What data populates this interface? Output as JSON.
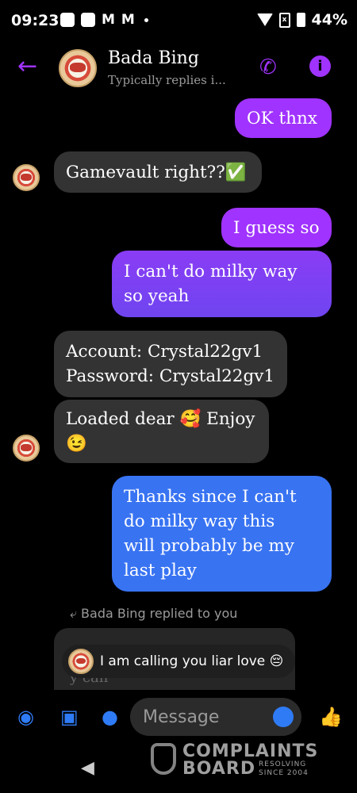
{
  "status_bar": {
    "time": "09:23",
    "gmail_1": "M",
    "gmail_2": "M",
    "sim": "x",
    "battery": "44%"
  },
  "header": {
    "back_icon": "arrow-left-icon",
    "contact_name": "Bada Bing",
    "subtitle": "Typically replies i...",
    "call_icon": "phone-icon",
    "info_label": "i"
  },
  "messages": [
    {
      "from": "me",
      "text": "OK thnx"
    },
    {
      "from": "them",
      "text": "Gamevault right??✅"
    },
    {
      "from": "me",
      "text": "I guess so"
    },
    {
      "from": "me",
      "text_lines": [
        "I can't do milky way",
        "so yeah"
      ]
    },
    {
      "from": "them",
      "text_lines": [
        "Account: Crystal22gv1",
        "Password: Crystal22gv1"
      ]
    },
    {
      "from": "them",
      "text_lines": [
        "Loaded dear 🥰 Enjoy",
        "😉"
      ]
    },
    {
      "from": "me",
      "text_lines": [
        "Thanks since I can't",
        "do milky way this",
        "will probably be my",
        "last play"
      ]
    }
  ],
  "reply": {
    "note": "Bada Bing replied to you",
    "quoted_fragment": "y can",
    "text": "I am calling you liar love 😔"
  },
  "composer": {
    "placeholder": "Message",
    "icons": [
      "camera-icon",
      "image-icon",
      "microphone-icon",
      "emoji-icon",
      "thumbs-up-icon"
    ]
  },
  "watermark": {
    "line1": "COMPLAINTS",
    "line2": "BOARD",
    "tag_line1": "RESOLVING",
    "tag_line2": "SINCE 2004"
  },
  "colors": {
    "accent": "#a033ff",
    "outgoing_blue": "#3873f2",
    "incoming_bg": "#333333"
  }
}
